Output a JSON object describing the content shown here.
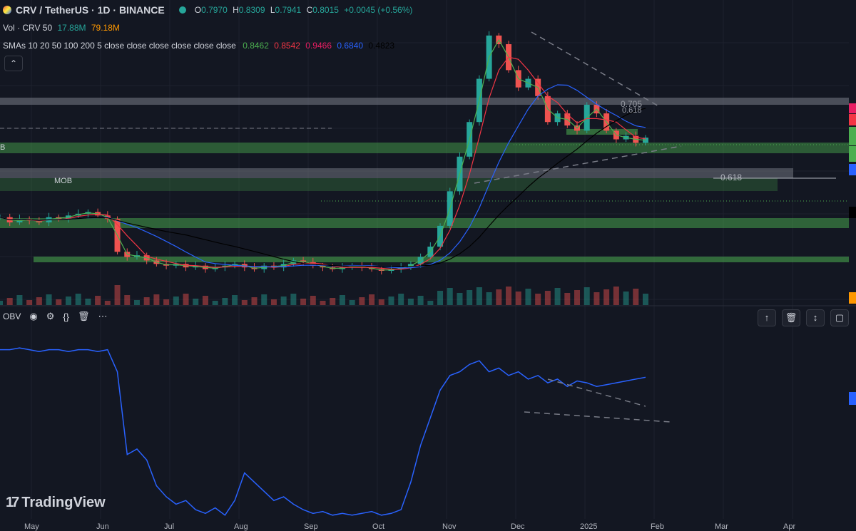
{
  "header": {
    "symbol_line": "CRV / TetherUS · 1D · BINANCE",
    "ohlc": {
      "o_label": "O",
      "o": "0.7970",
      "h_label": "H",
      "h": "0.8309",
      "l_label": "L",
      "l": "0.7941",
      "c_label": "C",
      "c": "0.8015",
      "change": "+0.0045 (+0.56%)"
    },
    "vol_label": "Vol · CRV 50",
    "vol_1": "17.88M",
    "vol_2": "79.18M",
    "sma_label": "SMAs 10 20 50 100 200 5 close close close close close close",
    "sma_values": [
      "0.8462",
      "0.8542",
      "0.9466",
      "0.6840",
      "0.4823"
    ],
    "collapse_icon": "chevron-up-icon"
  },
  "annotations": {
    "mob": "MOB",
    "b": "B",
    "fib_618_right": "0.618",
    "fib_705": "0.705",
    "fib_618_top": "0.618"
  },
  "obv_pane": {
    "label": "OBV",
    "tools": [
      "eye-icon",
      "gear-icon",
      "braces-icon",
      "trash-icon",
      "more-icon"
    ],
    "pane_tools": [
      "arrow-up-icon",
      "trash-icon",
      "collapse-icon",
      "maximize-icon"
    ]
  },
  "branding": {
    "logo_mark": "17",
    "logo_text": "TradingView"
  },
  "time_axis": [
    "May",
    "Jun",
    "Jul",
    "Aug",
    "Sep",
    "Oct",
    "Nov",
    "Dec",
    "2025",
    "Feb",
    "Mar",
    "Apr"
  ],
  "colors": {
    "background": "#131722",
    "up": "#26a69a",
    "down": "#ef5350",
    "sma10": "#4caf50",
    "sma20": "#f23645",
    "sma50": "#2962ff",
    "sma200": "#000000",
    "obv": "#2962ff",
    "zone_green": "#4caf50",
    "zone_gray": "#787b86"
  },
  "price_series_shape": [
    0.75,
    0.72,
    0.74,
    0.73,
    0.72,
    0.75,
    0.74,
    0.76,
    0.77,
    0.78,
    0.76,
    0.74,
    0.55,
    0.52,
    0.53,
    0.5,
    0.48,
    0.47,
    0.48,
    0.46,
    0.47,
    0.45,
    0.46,
    0.47,
    0.48,
    0.46,
    0.45,
    0.47,
    0.46,
    0.48,
    0.5,
    0.49,
    0.47,
    0.46,
    0.45,
    0.46,
    0.47,
    0.46,
    0.45,
    0.44,
    0.45,
    0.46,
    0.48,
    0.52,
    0.58,
    0.7,
    0.9,
    1.1,
    1.3,
    1.55,
    1.8,
    1.75,
    1.6,
    1.5,
    1.55,
    1.45,
    1.3,
    1.35,
    1.28,
    1.25,
    1.4,
    1.35,
    1.25,
    1.2,
    1.22,
    1.18,
    1.21
  ],
  "obv_series_shape": [
    0.92,
    0.92,
    0.93,
    0.92,
    0.91,
    0.92,
    0.92,
    0.91,
    0.92,
    0.92,
    0.91,
    0.92,
    0.8,
    0.35,
    0.38,
    0.32,
    0.18,
    0.12,
    0.08,
    0.1,
    0.05,
    0.03,
    0.06,
    0.02,
    0.1,
    0.25,
    0.2,
    0.15,
    0.1,
    0.12,
    0.08,
    0.05,
    0.03,
    0.04,
    0.02,
    0.03,
    0.02,
    0.03,
    0.04,
    0.02,
    0.03,
    0.05,
    0.2,
    0.4,
    0.55,
    0.7,
    0.78,
    0.8,
    0.84,
    0.86,
    0.8,
    0.82,
    0.78,
    0.8,
    0.76,
    0.78,
    0.74,
    0.76,
    0.72,
    0.75,
    0.74,
    0.72,
    0.73,
    0.74,
    0.75,
    0.76,
    0.77
  ]
}
